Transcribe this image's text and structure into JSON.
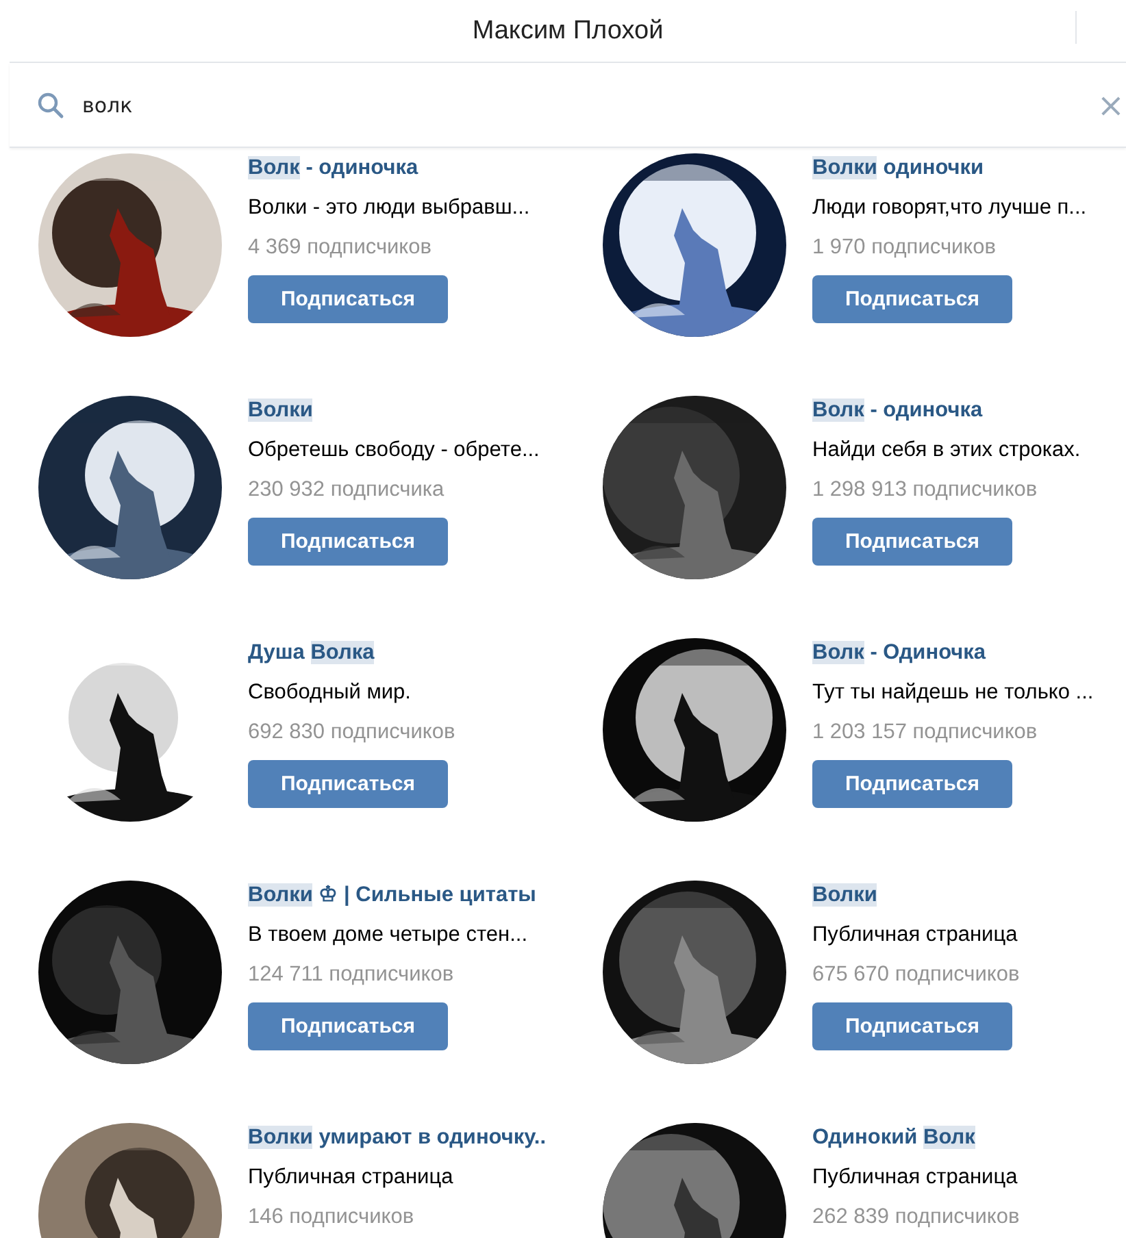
{
  "header": {
    "title": "Максим Плохой"
  },
  "search": {
    "value": "волк",
    "clear_icon": "×"
  },
  "groups": [
    {
      "name": [
        {
          "text": "Волк",
          "highlighted": true
        },
        {
          "text": " - одиночка",
          "highlighted": false
        }
      ],
      "description": "Волки - это люди выбравш...",
      "subscribers": "4 369 подписчиков",
      "button": "Подписаться"
    },
    {
      "name": [
        {
          "text": "Волки",
          "highlighted": true
        },
        {
          "text": " одиночки",
          "highlighted": false
        }
      ],
      "description": "Люди говорят,что лучше п...",
      "subscribers": "1 970 подписчиков",
      "button": "Подписаться"
    },
    {
      "name": [
        {
          "text": "Волки",
          "highlighted": true
        }
      ],
      "description": "Обретешь свободу - обрете...",
      "subscribers": "230 932 подписчика",
      "button": "Подписаться"
    },
    {
      "name": [
        {
          "text": "Волк",
          "highlighted": true
        },
        {
          "text": " - одиночка",
          "highlighted": false
        }
      ],
      "description": "Найди себя в этих строках.",
      "subscribers": "1 298 913 подписчиков",
      "button": "Подписаться"
    },
    {
      "name": [
        {
          "text": "Душа ",
          "highlighted": false
        },
        {
          "text": "Волка",
          "highlighted": true
        }
      ],
      "description": "Свободный мир.",
      "subscribers": "692 830 подписчиков",
      "button": "Подписаться"
    },
    {
      "name": [
        {
          "text": "Волк",
          "highlighted": true
        },
        {
          "text": " - Одиночка",
          "highlighted": false
        }
      ],
      "description": "Тут ты найдешь не только ...",
      "subscribers": "1 203 157 подписчиков",
      "button": "Подписаться"
    },
    {
      "name": [
        {
          "text": "Волки",
          "highlighted": true
        },
        {
          "text": " ♔ | Сильные цитаты",
          "highlighted": false
        }
      ],
      "description": "В твоем доме четыре стен...",
      "subscribers": "124 711 подписчиков",
      "button": "Подписаться"
    },
    {
      "name": [
        {
          "text": "Волки",
          "highlighted": true
        }
      ],
      "description": "Публичная страница",
      "subscribers": "675 670 подписчиков",
      "button": "Подписаться"
    },
    {
      "name": [
        {
          "text": "Волки",
          "highlighted": true
        },
        {
          "text": " умирают в одиночку..",
          "highlighted": false
        }
      ],
      "description": "Публичная страница",
      "subscribers": "146 подписчиков"
    },
    {
      "name": [
        {
          "text": "Одинокий ",
          "highlighted": false
        },
        {
          "text": "Волк",
          "highlighted": true
        }
      ],
      "description": "Публичная страница",
      "subscribers": "262 839 подписчиков"
    }
  ]
}
